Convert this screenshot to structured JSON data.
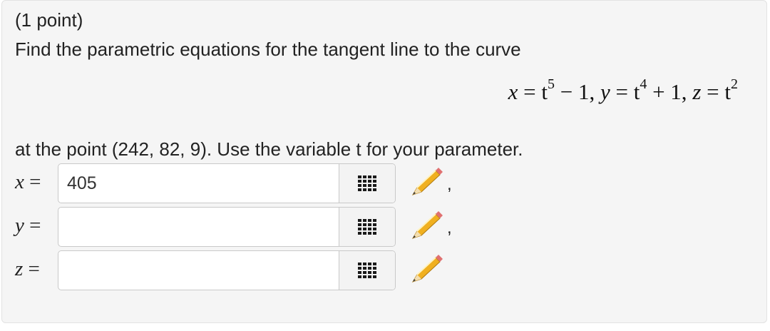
{
  "problem": {
    "points_label": "(1 point)",
    "prompt": "Find the parametric equations for the tangent line to the curve",
    "equation": {
      "x_lhs": "x",
      "eq1": " = t",
      "x_exp": "5",
      "x_rest": " − 1, ",
      "y_lhs": "y",
      "eq2": " = t",
      "y_exp": "4",
      "y_rest": " + 1, ",
      "z_lhs": "z",
      "eq3": " = t",
      "z_exp": "2"
    },
    "after_text": "at the point (242, 82, 9). Use the variable t for your parameter."
  },
  "answers": [
    {
      "var": "x",
      "eq": " =",
      "value": "405",
      "separator": ","
    },
    {
      "var": "y",
      "eq": " =",
      "value": "",
      "separator": ","
    },
    {
      "var": "z",
      "eq": " =",
      "value": "",
      "separator": ""
    }
  ],
  "icons": {
    "grid": "equation-editor-grid-icon",
    "pencil": "pencil-icon"
  },
  "colors": {
    "panel_bg": "#f5f5f5",
    "grid_icon": "#1a1a1a",
    "pencil_body": "#f0b020",
    "pencil_tip": "#c0392b"
  }
}
